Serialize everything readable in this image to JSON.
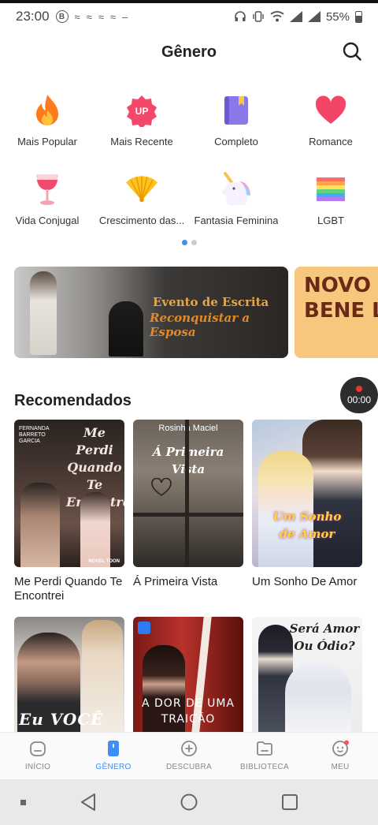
{
  "status_bar": {
    "time": "23:00",
    "left_icons": [
      "b-circle-icon",
      "notification-icon",
      "notification-icon",
      "notification-icon",
      "notification-icon",
      "more-icon"
    ],
    "battery": "55%"
  },
  "header": {
    "title": "Gênero"
  },
  "categories": [
    {
      "label": "Mais Popular",
      "icon": "fire-icon"
    },
    {
      "label": "Mais Recente",
      "icon": "up-badge-icon",
      "badge": "UP"
    },
    {
      "label": "Completo",
      "icon": "book-icon"
    },
    {
      "label": "Romance",
      "icon": "heart-icon"
    },
    {
      "label": "Vida Conjugal",
      "icon": "wine-glass-icon"
    },
    {
      "label": "Crescimento das...",
      "icon": "fan-icon"
    },
    {
      "label": "Fantasia Feminina",
      "icon": "unicorn-icon"
    },
    {
      "label": "LGBT",
      "icon": "rainbow-flag-icon"
    }
  ],
  "pager": {
    "pages": 2,
    "active": 1
  },
  "banners": [
    {
      "line1": "Evento de Escrita",
      "line2": "Reconquistar a Esposa"
    },
    {
      "text": "NOVO P DE BENE LANÇ"
    }
  ],
  "recommended": {
    "title": "Recomendados",
    "timer": "00:00",
    "books": [
      {
        "title": "Me Perdi Quando Te Encontrei",
        "author_on_cover": "FERNANDA BARRETO GARCIA",
        "cover_title": "Me Perdi Quando Te Encontrei",
        "publisher": "NOVEL TOON"
      },
      {
        "title": "Á Primeira Vista",
        "author_on_cover": "Rosinha Maciel",
        "cover_title": "Á Primeira Vista"
      },
      {
        "title": "Um Sonho De Amor",
        "cover_title": "Um Sonho de Amor"
      },
      {
        "cover_title": "Eu VOCÊ"
      },
      {
        "cover_title": "A DOR DE UMA TRAIÇÃO"
      },
      {
        "cover_title": "Será Amor Ou Ódio?"
      }
    ]
  },
  "bottom_nav": [
    {
      "label": "INÍCIO",
      "icon": "home-icon"
    },
    {
      "label": "GÊNERO",
      "icon": "genre-icon",
      "active": true
    },
    {
      "label": "DESCUBRA",
      "icon": "discover-icon"
    },
    {
      "label": "BIBLIOTECA",
      "icon": "library-icon"
    },
    {
      "label": "MEU",
      "icon": "profile-icon",
      "has_dot": true
    }
  ],
  "colors": {
    "accent": "#3f8ef5",
    "notification_dot": "#ff4d6a"
  }
}
